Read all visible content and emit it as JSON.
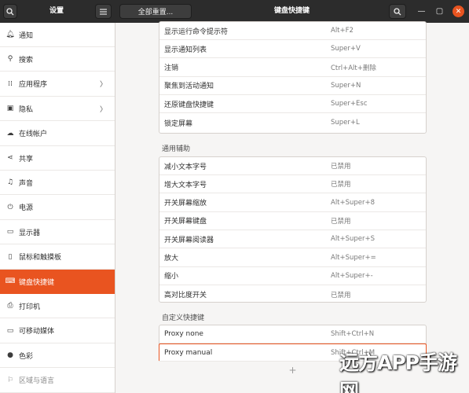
{
  "header": {
    "settings_title": "设置",
    "reset_all_label": "全部重置...",
    "panel_title": "键盘快捷键",
    "search_icon": "search-icon",
    "menu_icon": "hamburger-menu-icon",
    "minimize_glyph": "—",
    "maximize_glyph": "▢",
    "close_glyph": "✕"
  },
  "sidebar": {
    "items": [
      {
        "label": "通知",
        "icon": "bell-icon",
        "glyph": "🔔︎"
      },
      {
        "label": "搜索",
        "icon": "search-icon",
        "glyph": "⚲"
      },
      {
        "label": "应用程序",
        "icon": "apps-grid-icon",
        "glyph": "⁞⁞",
        "chevron": "〉"
      },
      {
        "label": "隐私",
        "icon": "lock-icon",
        "glyph": "▣",
        "chevron": "〉"
      },
      {
        "label": "在线帐户",
        "icon": "cloud-icon",
        "glyph": "☁"
      },
      {
        "label": "共享",
        "icon": "share-icon",
        "glyph": "⋖"
      },
      {
        "label": "声音",
        "icon": "music-note-icon",
        "glyph": "♫"
      },
      {
        "label": "电源",
        "icon": "power-icon",
        "glyph": "⏻"
      },
      {
        "label": "显示器",
        "icon": "display-icon",
        "glyph": "▭"
      },
      {
        "label": "鼠标和触摸板",
        "icon": "mouse-icon",
        "glyph": "▯"
      },
      {
        "label": "键盘快捷键",
        "icon": "keyboard-icon",
        "glyph": "⌨"
      },
      {
        "label": "打印机",
        "icon": "printer-icon",
        "glyph": "⎙"
      },
      {
        "label": "可移动媒体",
        "icon": "removable-media-icon",
        "glyph": "▭"
      },
      {
        "label": "色彩",
        "icon": "color-palette-icon",
        "glyph": "●"
      },
      {
        "label": "区域与语言",
        "icon": "region-flag-icon",
        "glyph": "⚐"
      }
    ],
    "active_index": 10
  },
  "shortcuts": {
    "top_rows": [
      {
        "name": "显示运行命令提示符",
        "accel": "Alt+F2"
      },
      {
        "name": "显示通知列表",
        "accel": "Super+V"
      },
      {
        "name": "注销",
        "accel": "Ctrl+Alt+删除"
      },
      {
        "name": "聚焦到活动通知",
        "accel": "Super+N"
      },
      {
        "name": "还原键盘快捷键",
        "accel": "Super+Esc"
      },
      {
        "name": "锁定屏幕",
        "accel": "Super+L"
      }
    ],
    "accessibility_title": "通用辅助",
    "accessibility_rows": [
      {
        "name": "减小文本字号",
        "accel": "已禁用"
      },
      {
        "name": "增大文本字号",
        "accel": "已禁用"
      },
      {
        "name": "开关屏幕缩放",
        "accel": "Alt+Super+8"
      },
      {
        "name": "开关屏幕键盘",
        "accel": "已禁用"
      },
      {
        "name": "开关屏幕阅读器",
        "accel": "Alt+Super+S"
      },
      {
        "name": "放大",
        "accel": "Alt+Super+="
      },
      {
        "name": "缩小",
        "accel": "Alt+Super+-"
      },
      {
        "name": "高对比度开关",
        "accel": "已禁用"
      }
    ],
    "custom_title": "自定义快捷键",
    "custom_rows": [
      {
        "name": "Proxy none",
        "accel": "Shift+Ctrl+N"
      },
      {
        "name": "Proxy manual",
        "accel": "Shift+Ctrl+M"
      }
    ],
    "add_glyph": "+"
  },
  "watermark": "远方APP手游网",
  "colors": {
    "accent": "#e95420",
    "header_bg": "#2c2c2c"
  }
}
